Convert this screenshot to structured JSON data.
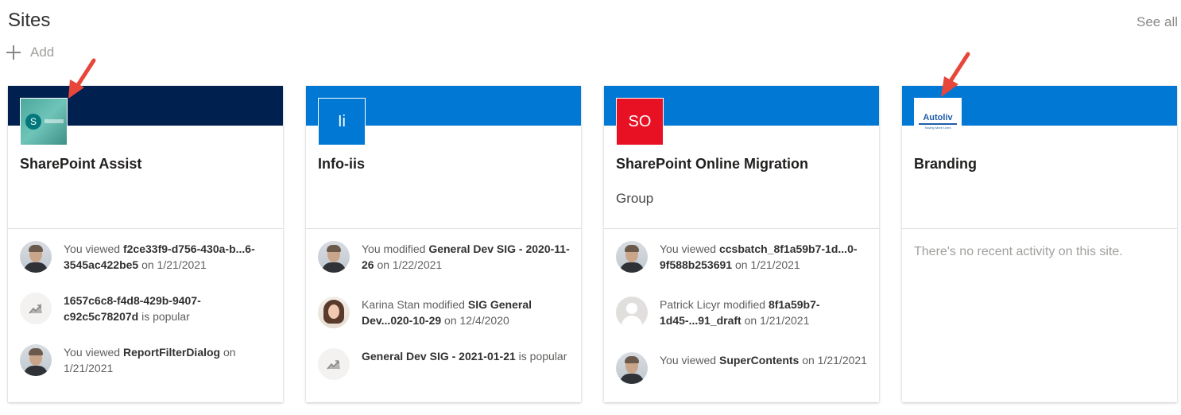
{
  "header": {
    "title": "Sites",
    "see_all": "See all",
    "add_label": "Add"
  },
  "cards": [
    {
      "title": "SharePoint Assist",
      "subtitle": "",
      "band_color": "#002050",
      "logo_text": "S",
      "activities": [
        {
          "pre": "You viewed ",
          "bold": "f2ce33f9-d756-430a-b...6-3545ac422be5",
          "post": " on 1/21/2021",
          "icon": "person-avatar"
        },
        {
          "pre": "",
          "bold": "1657c6c8-f4d8-429b-9407-c92c5c78207d",
          "post": " is popular",
          "icon": "trending-icon"
        },
        {
          "pre": "You viewed ",
          "bold": "ReportFilterDialog",
          "post": " on 1/21/2021",
          "icon": "person-avatar"
        }
      ]
    },
    {
      "title": "Info-iis",
      "subtitle": "",
      "band_color": "#0078d4",
      "logo_text": "Ii",
      "logo_color": "#0078d4",
      "activities": [
        {
          "pre": "You modified ",
          "bold": "General Dev SIG - 2020-11-26",
          "post": " on 1/22/2021",
          "icon": "person-avatar"
        },
        {
          "pre": "Karina Stan modified ",
          "bold": "SIG General Dev...020-10-29",
          "post": " on 12/4/2020",
          "icon": "woman-avatar"
        },
        {
          "pre": "",
          "bold": "General Dev SIG - 2021-01-21",
          "post": " is popular",
          "icon": "trending-icon"
        }
      ]
    },
    {
      "title": "SharePoint Online Migration",
      "subtitle": "Group",
      "band_color": "#0078d4",
      "logo_text": "SO",
      "logo_color": "#e81123",
      "activities": [
        {
          "pre": "You viewed ",
          "bold": "ccsbatch_8f1a59b7-1d...0-9f588b253691",
          "post": " on 1/21/2021",
          "icon": "person-avatar"
        },
        {
          "pre": "Patrick Licyr modified ",
          "bold": "8f1a59b7-1d45-...91_draft",
          "post": " on 1/21/2021",
          "icon": "generic-avatar"
        },
        {
          "pre": "You viewed ",
          "bold": "SuperContents",
          "post": " on 1/21/2021",
          "icon": "person-avatar"
        }
      ]
    },
    {
      "title": "Branding",
      "subtitle": "",
      "band_color": "#0078d4",
      "logo_text": "Autoliv",
      "logo_tag": "Saving More Lives",
      "empty_message": "There's no recent activity on this site.",
      "activities": []
    }
  ],
  "colors": {
    "annotation_arrow": "#e8463a"
  }
}
